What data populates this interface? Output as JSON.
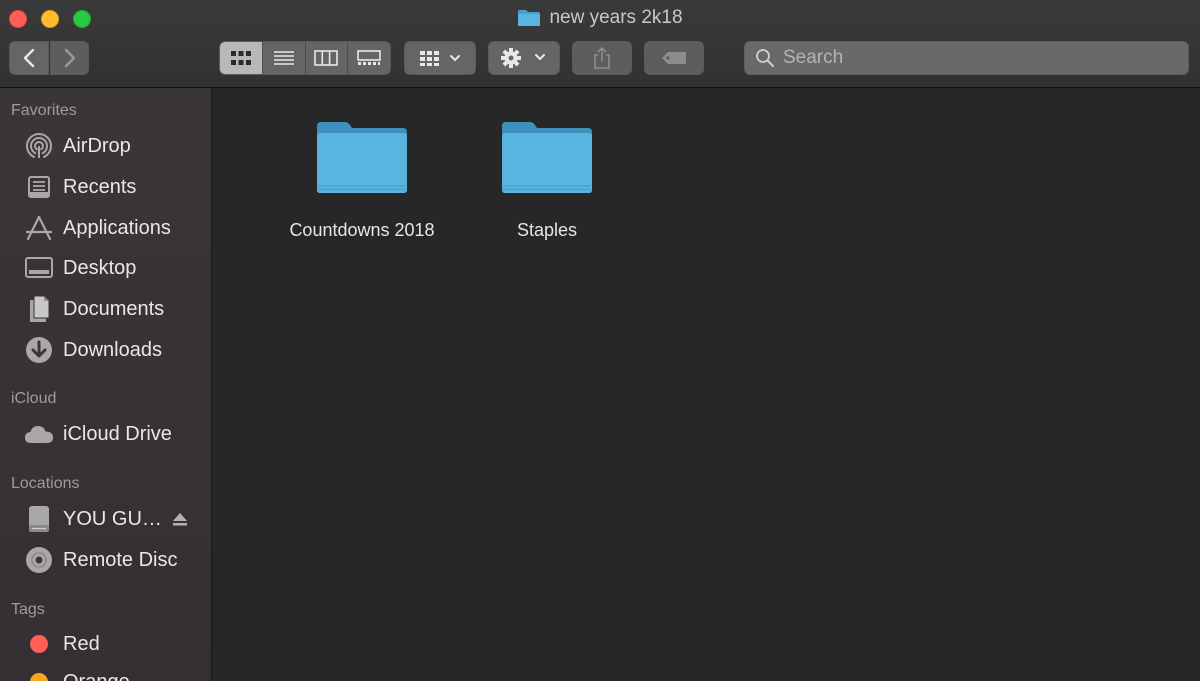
{
  "window": {
    "title": "new years 2k18"
  },
  "toolbar": {
    "search_placeholder": "Search"
  },
  "sidebar": {
    "favorites_header": "Favorites",
    "favorites": [
      {
        "label": "AirDrop",
        "icon": "airdrop-icon"
      },
      {
        "label": "Recents",
        "icon": "recents-icon"
      },
      {
        "label": "Applications",
        "icon": "applications-icon"
      },
      {
        "label": "Desktop",
        "icon": "desktop-icon"
      },
      {
        "label": "Documents",
        "icon": "documents-icon"
      },
      {
        "label": "Downloads",
        "icon": "downloads-icon"
      }
    ],
    "icloud_header": "iCloud",
    "icloud": [
      {
        "label": "iCloud Drive",
        "icon": "cloud-icon"
      }
    ],
    "locations_header": "Locations",
    "locations": [
      {
        "label": "YOU GU…",
        "icon": "drive-icon"
      },
      {
        "label": "Remote Disc",
        "icon": "disc-icon"
      }
    ],
    "tags_header": "Tags",
    "tags": [
      {
        "label": "Red",
        "color": "#fe5f57"
      },
      {
        "label": "Orange",
        "color": "#f5a623"
      }
    ]
  },
  "content": {
    "items": [
      {
        "label": "Countdowns 2018",
        "icon": "folder-icon"
      },
      {
        "label": "Staples",
        "icon": "folder-icon"
      }
    ]
  },
  "colors": {
    "folder": "#5ab4e0",
    "folder_tab": "#4aa0cc"
  }
}
